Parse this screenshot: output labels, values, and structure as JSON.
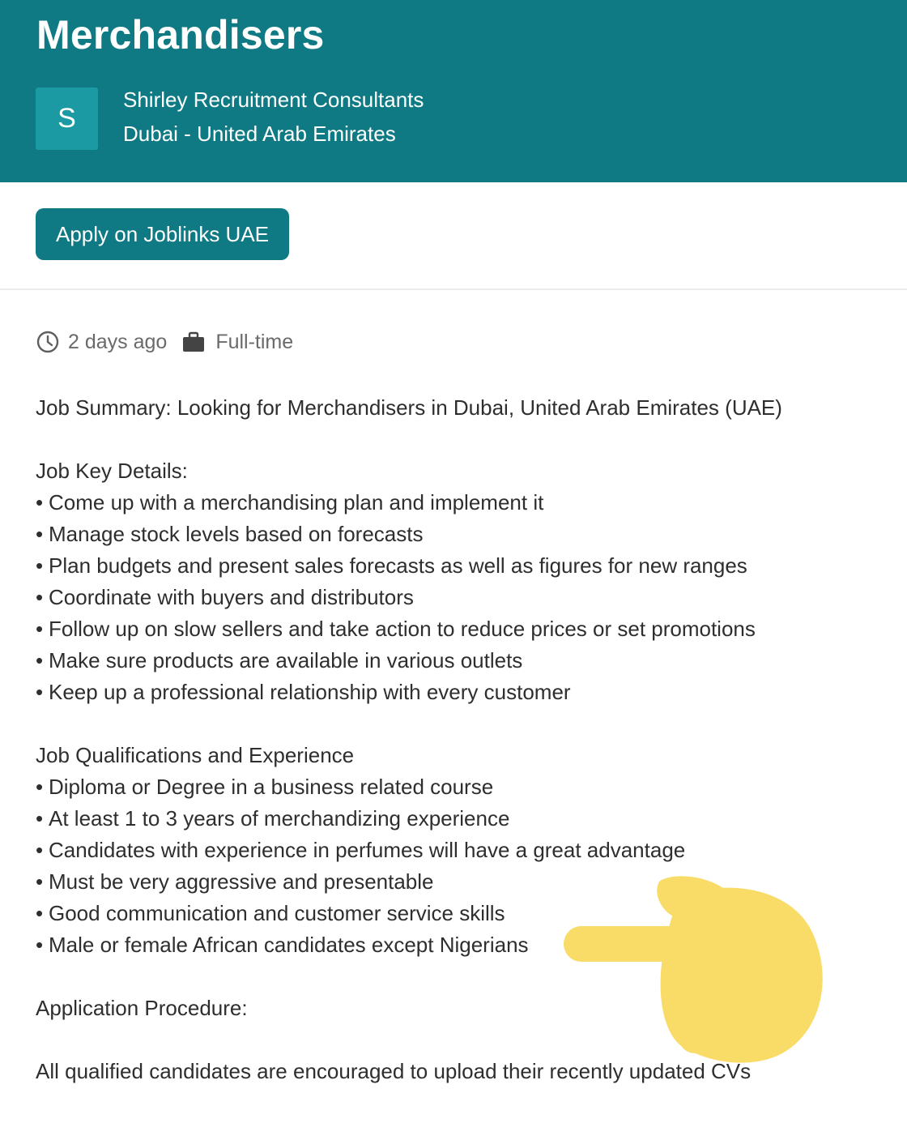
{
  "header": {
    "title": "Merchandisers",
    "logo_letter": "S",
    "company": "Shirley Recruitment Consultants",
    "location": "Dubai - United Arab Emirates"
  },
  "apply": {
    "label": "Apply on Joblinks UAE"
  },
  "meta": {
    "posted": "2 days ago",
    "type": "Full-time",
    "icons": [
      "clock-icon",
      "briefcase-icon"
    ]
  },
  "summary": "Job Summary: Looking for Merchandisers in Dubai, United Arab Emirates (UAE)",
  "key_details": {
    "heading": "Job Key Details:",
    "items": [
      "Come up with a merchandising plan and implement it",
      "Manage stock levels based on forecasts",
      "Plan budgets and present sales forecasts as well as figures for new ranges",
      "Coordinate with buyers and distributors",
      "Follow up on slow sellers and take action to reduce prices or set promotions",
      "Make sure products are available in various outlets",
      "Keep up a professional relationship with every customer"
    ]
  },
  "qualifications": {
    "heading": "Job Qualifications and Experience",
    "items": [
      "Diploma or Degree in a business related course",
      "At least 1 to 3 years of merchandizing experience",
      "Candidates with experience in perfumes will have a great advantage",
      "Must be very aggressive and presentable",
      "Good communication and customer service skills",
      "Male or female African candidates except Nigerians"
    ]
  },
  "procedure": {
    "heading": "Application Procedure:",
    "text": "All qualified candidates are encouraged to upload their recently updated CVs"
  },
  "colors": {
    "brand": "#0f7a83",
    "logo_bg": "#1c9aa4",
    "hand_emoji": "#f8d548"
  }
}
